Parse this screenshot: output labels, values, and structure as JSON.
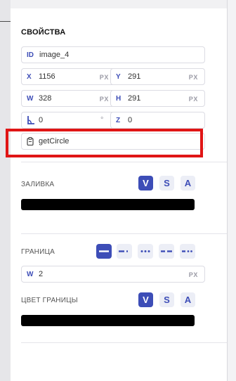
{
  "properties": {
    "title": "СВОЙСТВА",
    "id": {
      "prefix": "ID",
      "value": "image_4"
    },
    "x": {
      "prefix": "X",
      "value": "1156",
      "unit": "PX"
    },
    "y": {
      "prefix": "Y",
      "value": "291",
      "unit": "PX"
    },
    "w": {
      "prefix": "W",
      "value": "328",
      "unit": "PX"
    },
    "h": {
      "prefix": "H",
      "value": "291",
      "unit": "PX"
    },
    "rotation": {
      "value": "0",
      "unit": "°"
    },
    "z": {
      "prefix": "Z",
      "value": "0"
    },
    "function": {
      "icon": "clipboard-icon",
      "value": "getCircle"
    }
  },
  "fill": {
    "label": "ЗАЛИВКА",
    "modes": [
      "V",
      "S",
      "A"
    ],
    "active_mode": "V",
    "color": "#000000"
  },
  "border": {
    "label": "ГРАНИЦА",
    "styles": [
      "solid-line",
      "dash-dot-line",
      "dotted-line",
      "dashed-line",
      "dash-dot-dot-line"
    ],
    "active_style": "solid-line",
    "width": {
      "prefix": "W",
      "value": "2",
      "unit": "PX"
    },
    "color_label": "ЦВЕТ ГРАНИЦЫ",
    "modes": [
      "V",
      "S",
      "A"
    ],
    "active_mode": "V",
    "color": "#000000"
  },
  "colors": {
    "accent": "#3d4db7",
    "highlight": "#e01515"
  }
}
